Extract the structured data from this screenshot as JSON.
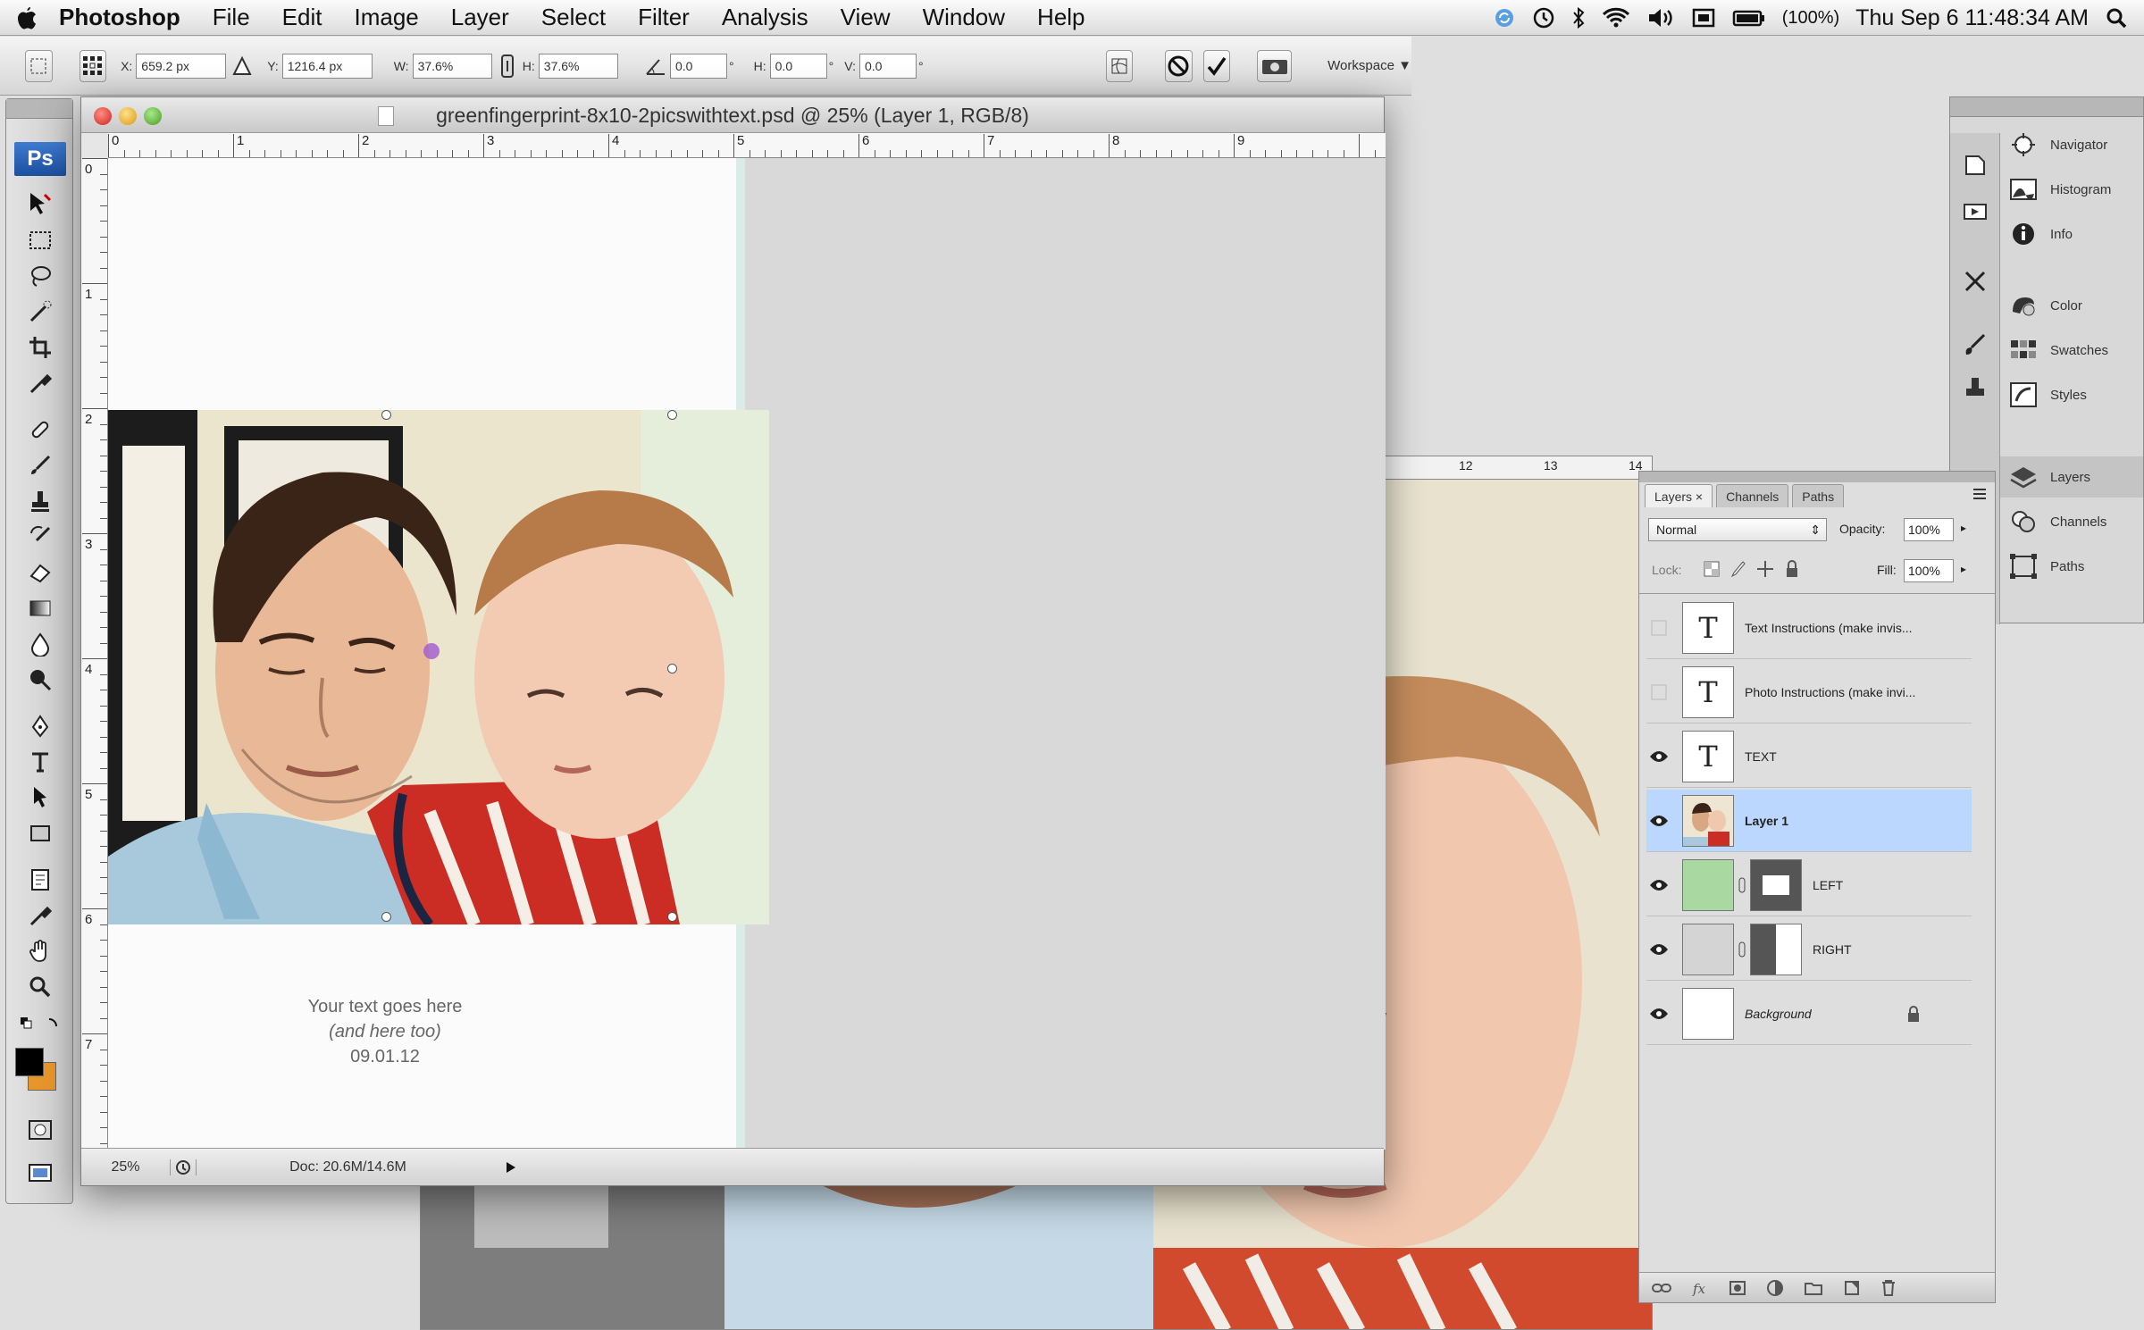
{
  "menubar": {
    "app_name": "Photoshop",
    "items": [
      "File",
      "Edit",
      "Image",
      "Layer",
      "Select",
      "Filter",
      "Analysis",
      "View",
      "Window",
      "Help"
    ],
    "battery": "(100%)",
    "datetime": "Thu Sep 6  11:48:34 AM"
  },
  "options_bar": {
    "x_label": "X:",
    "x_value": "659.2 px",
    "y_label": "Y:",
    "y_value": "1216.4 px",
    "w_label": "W:",
    "w_value": "37.6%",
    "h_label": "H:",
    "h_value": "37.6%",
    "angle_value": "0.0",
    "deg1": "°",
    "hskew_label": "H:",
    "hskew_value": "0.0",
    "vskew_label": "V:",
    "vskew_value": "0.0",
    "deg2": "°",
    "deg3": "°",
    "workspace_label": "Workspace"
  },
  "tools": {
    "logo": "Ps"
  },
  "document": {
    "title": "greenfingerprint-8x10-2picswithtext.psd @ 25% (Layer 1, RGB/8)",
    "text_line1": "Your text goes here",
    "text_line2": "(and here too)",
    "text_line3": "09.01.12",
    "zoom": "25%",
    "doc_size": "Doc: 20.6M/14.6M",
    "ruler_top": [
      "0",
      "1",
      "2",
      "3",
      "4",
      "5",
      "6",
      "7",
      "8",
      "9"
    ],
    "ruler_left": [
      "0",
      "1",
      "2",
      "3",
      "4",
      "5",
      "6",
      "7"
    ]
  },
  "background_document": {
    "ruler_labels": [
      "12",
      "13",
      "14"
    ]
  },
  "dock": {
    "groups": [
      [
        "Navigator",
        "Histogram",
        "Info"
      ],
      [
        "Color",
        "Swatches",
        "Styles"
      ],
      [
        "Layers",
        "Channels",
        "Paths"
      ]
    ]
  },
  "layers_panel": {
    "tabs": [
      "Layers",
      "Channels",
      "Paths"
    ],
    "close_glyph": "×",
    "blend_mode": "Normal",
    "opacity_label": "Opacity:",
    "opacity_value": "100%",
    "lock_label": "Lock:",
    "fill_label": "Fill:",
    "fill_value": "100%",
    "layers": [
      {
        "name": "Text Instructions (make invis...",
        "type": "text",
        "visible": false
      },
      {
        "name": "Photo Instructions (make invi...",
        "type": "text",
        "visible": false
      },
      {
        "name": "TEXT",
        "type": "text",
        "visible": true
      },
      {
        "name": "Layer 1",
        "type": "image",
        "visible": true,
        "selected": true
      },
      {
        "name": "LEFT",
        "type": "fill-mask",
        "visible": true
      },
      {
        "name": "RIGHT",
        "type": "fill-mask",
        "visible": true
      },
      {
        "name": "Background",
        "type": "background",
        "visible": true
      }
    ],
    "text_thumb_glyph": "T"
  },
  "colors": {
    "selection_blue": "#bcd7fd",
    "ps_logo_blue": "#2a62b8",
    "left_fill_green": "#a9d9a0",
    "foreground": "#000000",
    "background_swatch": "#e8962a"
  }
}
